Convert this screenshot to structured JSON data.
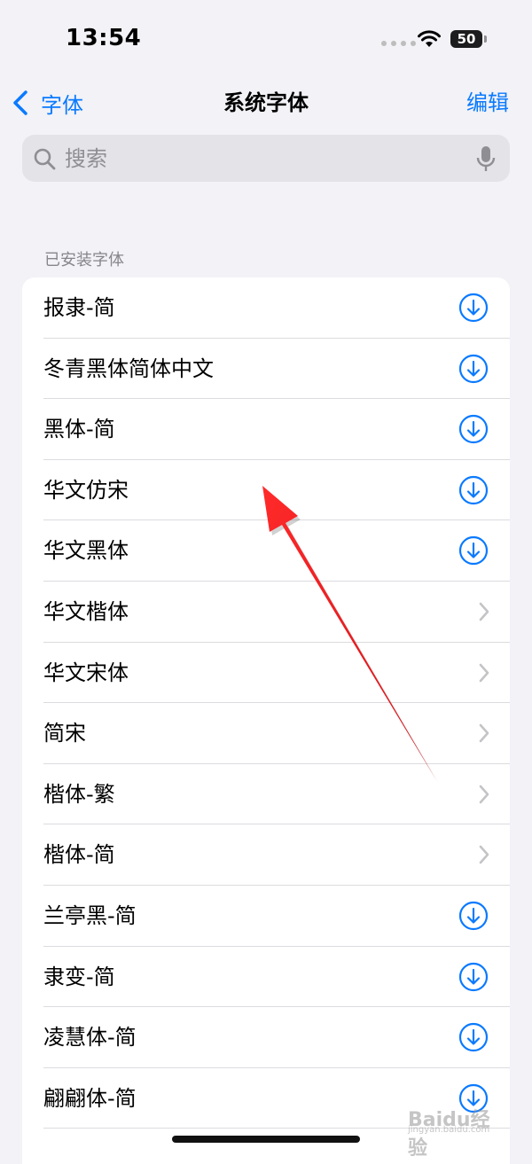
{
  "status_bar": {
    "time": "13:54",
    "battery_level": "50"
  },
  "nav": {
    "back_label": "字体",
    "title": "系统字体",
    "edit_label": "编辑"
  },
  "search": {
    "placeholder": "搜索",
    "value": ""
  },
  "section": {
    "header": "已安装字体"
  },
  "fonts": [
    {
      "name": "报隶-简",
      "action": "download-icon"
    },
    {
      "name": "冬青黑体简体中文",
      "action": "download-icon"
    },
    {
      "name": "黑体-简",
      "action": "download-icon"
    },
    {
      "name": "华文仿宋",
      "action": "download-icon"
    },
    {
      "name": "华文黑体",
      "action": "download-icon"
    },
    {
      "name": "华文楷体",
      "action": "chevron-right-icon"
    },
    {
      "name": "华文宋体",
      "action": "chevron-right-icon"
    },
    {
      "name": "简宋",
      "action": "chevron-right-icon"
    },
    {
      "name": "楷体-繁",
      "action": "chevron-right-icon"
    },
    {
      "name": "楷体-简",
      "action": "chevron-right-icon"
    },
    {
      "name": "兰亭黑-简",
      "action": "download-icon"
    },
    {
      "name": "隶变-简",
      "action": "download-icon"
    },
    {
      "name": "凌慧体-简",
      "action": "download-icon"
    },
    {
      "name": "翩翩体-简",
      "action": "download-icon"
    }
  ],
  "watermark": {
    "text": "Baidu经验",
    "sub": "jingyan.baidu.com"
  },
  "colors": {
    "accent": "#0a7aff",
    "background": "#f2f2f7",
    "annotation_arrow": "#e8141c"
  }
}
